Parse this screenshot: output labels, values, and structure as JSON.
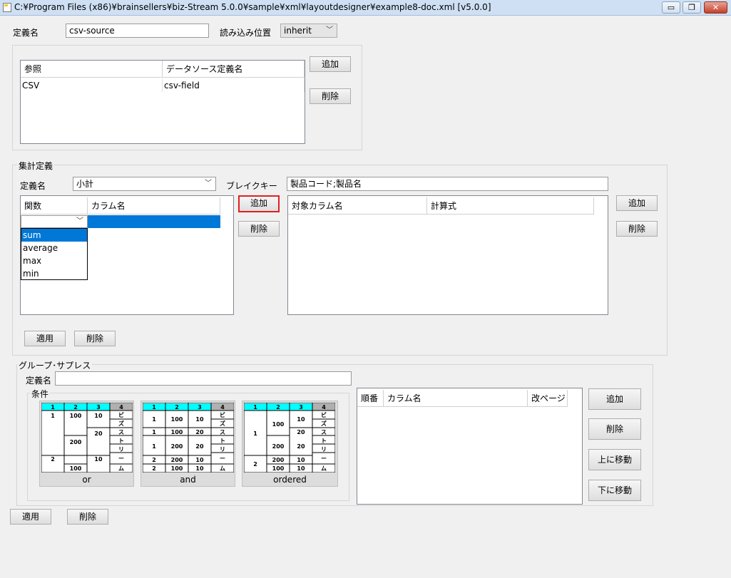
{
  "window": {
    "title": "C:¥Program Files (x86)¥brainsellers¥biz-Stream 5.0.0¥sample¥xml¥layoutdesigner¥example8-doc.xml [v5.0.0]",
    "min_glyph": "▭",
    "restore_glyph": "❐",
    "close_glyph": "✕"
  },
  "top": {
    "name_label": "定義名",
    "name_value": "csv-source",
    "read_pos_label": "読み込み位置",
    "read_pos_value": "inherit",
    "ref_table": {
      "headers": [
        "参照",
        "データソース定義名"
      ],
      "rows": [
        [
          "CSV",
          "csv-field"
        ]
      ]
    },
    "add_label": "追加",
    "delete_label": "削除"
  },
  "aggregate": {
    "group_title": "集計定義",
    "name_label": "定義名",
    "name_value": "小計",
    "break_label": "ブレイクキー",
    "break_value": "製品コード;製品名",
    "func_table": {
      "headers": [
        "関数",
        "カラム名"
      ]
    },
    "func_options": [
      "sum",
      "average",
      "max",
      "min"
    ],
    "func_selected": "sum",
    "mid_add": "追加",
    "mid_delete": "削除",
    "calc_table": {
      "headers": [
        "対象カラム名",
        "計算式"
      ]
    },
    "right_add": "追加",
    "right_delete": "削除",
    "apply_label": "適用",
    "delete_label": "削除"
  },
  "suppress": {
    "group_title": "グループ･サプレス",
    "name_label": "定義名",
    "name_value": "",
    "cond_title": "条件",
    "cond_options": [
      "or",
      "and",
      "ordered"
    ],
    "order_table": {
      "headers": [
        "順番",
        "カラム名",
        "改ページ"
      ]
    },
    "add": "追加",
    "delete": "削除",
    "move_up": "上に移動",
    "move_down": "下に移動"
  },
  "bottom": {
    "apply_label": "適用",
    "delete_label": "削除"
  },
  "mini_table": {
    "headers": [
      "1",
      "2",
      "3",
      "4"
    ],
    "col4": [
      "ビ",
      "ズ",
      "ス",
      "ト",
      "リ",
      "ー",
      "ム"
    ],
    "or": {
      "c1": [
        "1",
        "2"
      ],
      "c2": [
        "100",
        "200",
        "100"
      ],
      "c3": [
        "10",
        "20",
        "10"
      ]
    },
    "and": {
      "rows": [
        [
          "1",
          "100",
          "10"
        ],
        [
          "1",
          "100",
          "20"
        ],
        [
          "1",
          "200",
          "20"
        ],
        [
          "2",
          "200",
          "10"
        ],
        [
          "2",
          "100",
          "10"
        ]
      ]
    },
    "ordered": {
      "c1": [
        "1",
        "2"
      ],
      "c2": [
        "100",
        "200",
        "200",
        "100"
      ],
      "c3": [
        "10",
        "20",
        "20",
        "10",
        "10"
      ]
    }
  },
  "colors": {
    "header_cyan": "#00ffff",
    "header_gray": "#b0b0b0",
    "select_blue": "#0078d7",
    "focus_red": "#e02020"
  }
}
